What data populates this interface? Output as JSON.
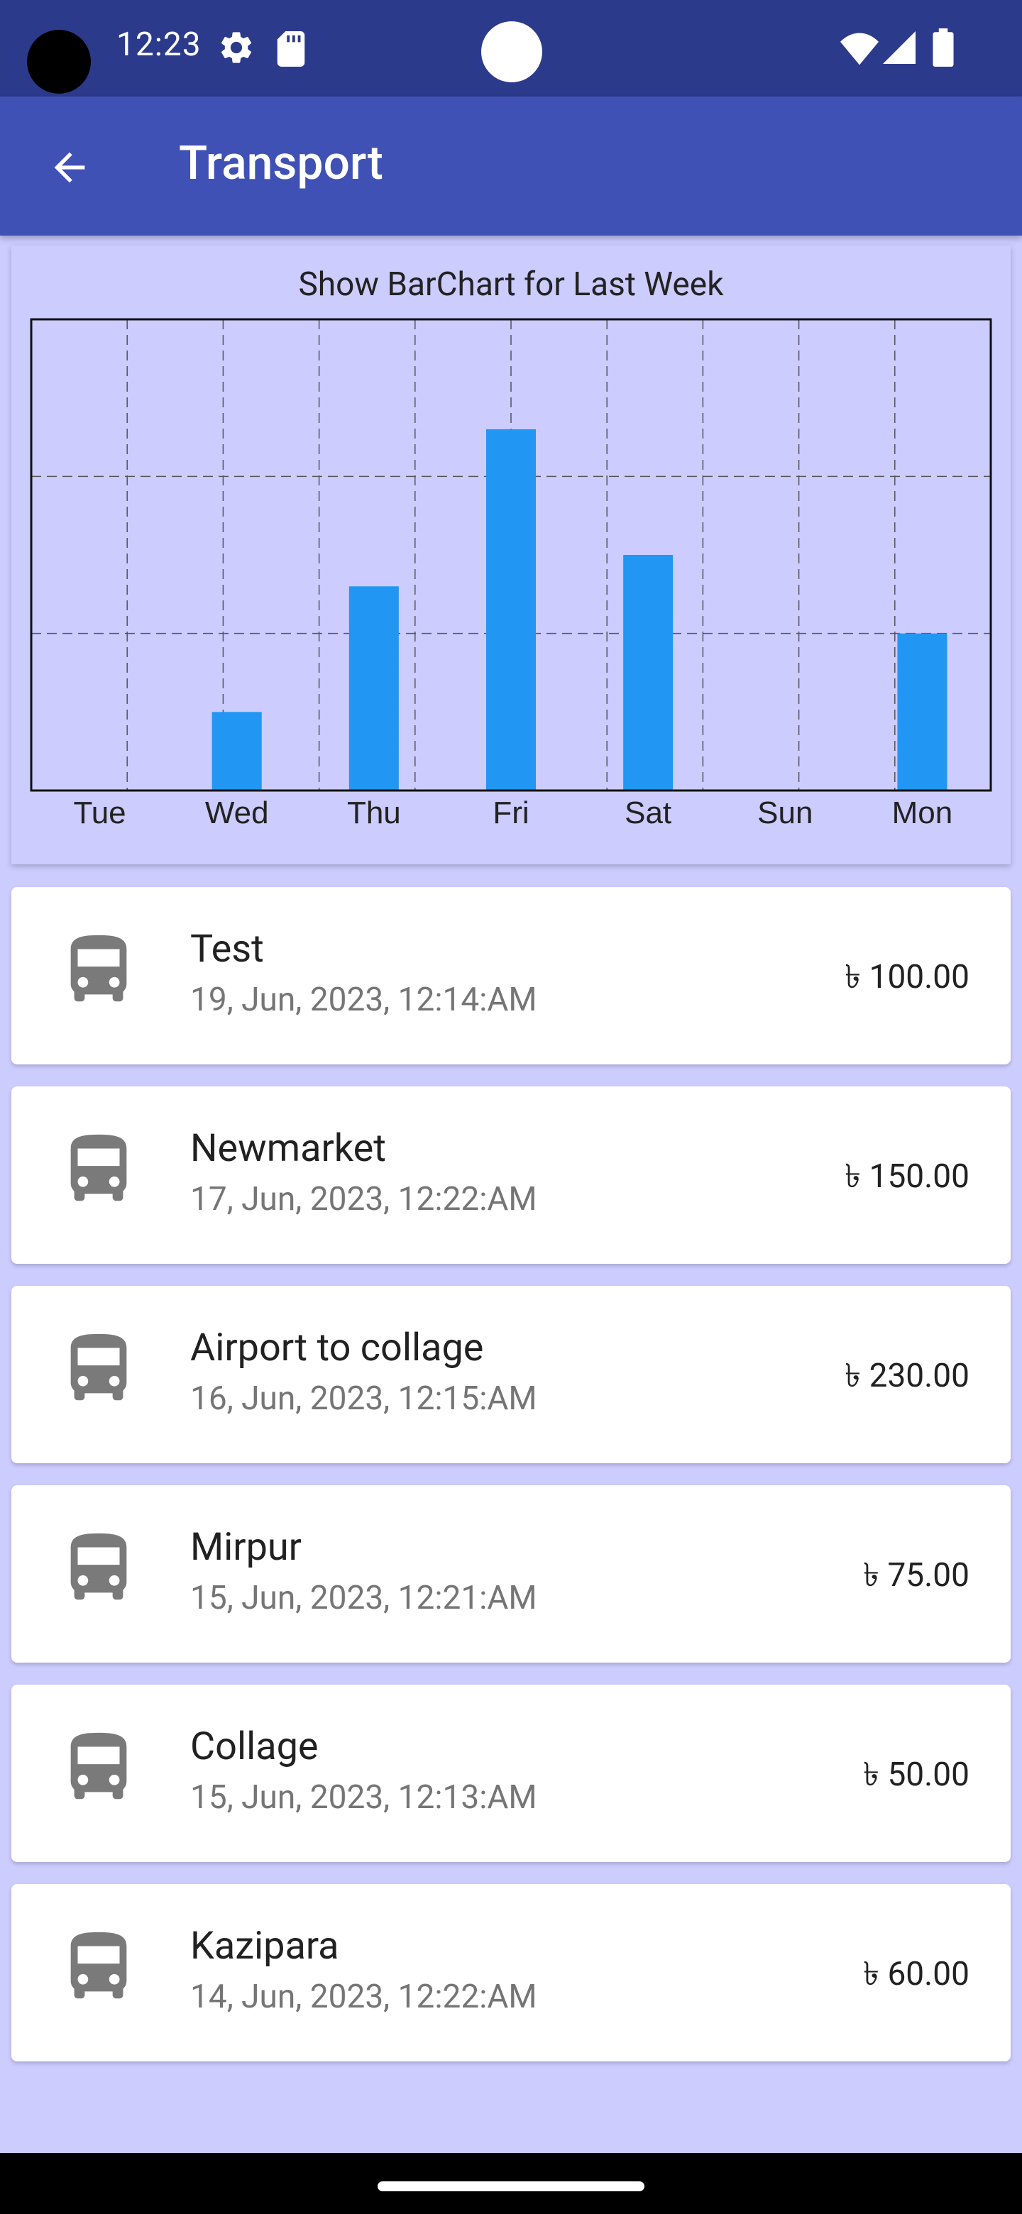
{
  "status_bar": {
    "time": "12:23"
  },
  "app_bar": {
    "title": "Transport"
  },
  "chart": {
    "title": "Show BarChart for Last Week",
    "chart_data": {
      "type": "bar",
      "title": "Show BarChart for Last Week",
      "categories": [
        "Tue",
        "Wed",
        "Thu",
        "Fri",
        "Sat",
        "Sun",
        "Mon"
      ],
      "values": [
        0,
        50,
        130,
        230,
        150,
        0,
        100
      ],
      "ylim": [
        0,
        300
      ],
      "grid": true,
      "bar_color": "#2196F3"
    }
  },
  "transactions": [
    {
      "name": "Test",
      "date": "19, Jun, 2023, 12:14:AM",
      "amount": "৳ 100.00"
    },
    {
      "name": "Newmarket",
      "date": "17, Jun, 2023, 12:22:AM",
      "amount": "৳ 150.00"
    },
    {
      "name": "Airport to collage",
      "date": "16, Jun, 2023, 12:15:AM",
      "amount": "৳ 230.00"
    },
    {
      "name": "Mirpur",
      "date": "15, Jun, 2023, 12:21:AM",
      "amount": "৳ 75.00"
    },
    {
      "name": "Collage",
      "date": "15, Jun, 2023, 12:13:AM",
      "amount": "৳ 50.00"
    },
    {
      "name": "Kazipara",
      "date": "14, Jun, 2023, 12:22:AM",
      "amount": "৳ 60.00"
    }
  ],
  "colors": {
    "status_bar": "#2C3A8C",
    "app_bar": "#3F51B5",
    "background": "#CCCCFF",
    "bar": "#2196F3",
    "icon": "#7A7A7A"
  }
}
